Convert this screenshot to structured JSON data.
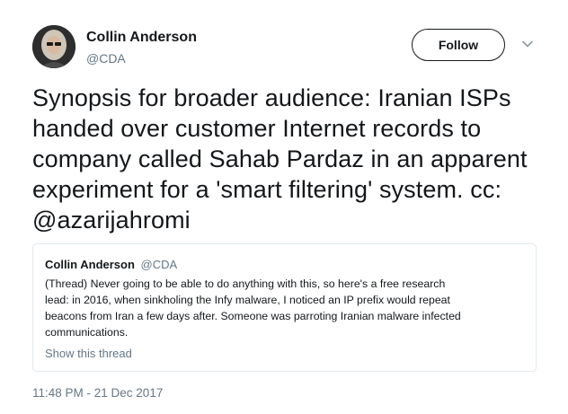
{
  "author": {
    "display_name": "Collin Anderson",
    "handle": "@CDA"
  },
  "header": {
    "follow_label": "Follow",
    "menu_icon": "chevron-down-icon"
  },
  "tweet": {
    "text_lines": [
      "Synopsis for broader audience: Iranian ISPs",
      "handed over customer Internet records to",
      "company called Sahab Pardaz in an apparent",
      "experiment for a 'smart filtering' system. cc:",
      "@azarijahromi"
    ],
    "timestamp": "11:48 PM - 21 Dec 2017"
  },
  "quoted_tweet": {
    "display_name": "Collin Anderson",
    "handle": "@CDA",
    "text_lines": [
      "(Thread) Never going to be able to do anything with this, so here's a free research",
      "lead: in 2016, when sinkholing the Infy malware, I noticed an IP prefix would repeat",
      "beacons from Iran a few days after. Someone was parroting Iranian malware infected",
      "communications."
    ],
    "show_thread_label": "Show this thread"
  },
  "colors": {
    "text": "#14171a",
    "secondary": "#657786",
    "border": "#e1e8ed"
  }
}
